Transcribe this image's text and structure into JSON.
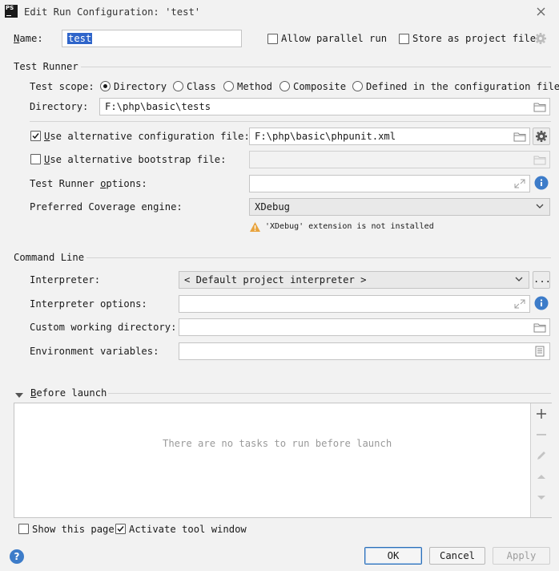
{
  "window": {
    "title": "Edit Run Configuration: 'test'",
    "app_icon_text": "PS"
  },
  "top": {
    "name_label": "Name:",
    "name_value": "test",
    "allow_parallel_label": "Allow parallel run",
    "store_project_label": "Store as project file"
  },
  "test_runner": {
    "section_title": "Test Runner",
    "scope_label": "Test scope:",
    "scopes": [
      "Directory",
      "Class",
      "Method",
      "Composite",
      "Defined in the configuration file"
    ],
    "selected_scope": "Directory",
    "directory_label": "Directory:",
    "directory_value": "F:\\php\\basic\\tests",
    "alt_config_label": "Use alternative configuration file:",
    "alt_config_checked": true,
    "alt_config_value": "F:\\php\\basic\\phpunit.xml",
    "alt_bootstrap_label": "Use alternative bootstrap file:",
    "alt_bootstrap_checked": false,
    "runner_options_label": "Test Runner options:",
    "coverage_label": "Preferred Coverage engine:",
    "coverage_value": "XDebug",
    "warning_text": "'XDebug' extension is not installed"
  },
  "command_line": {
    "section_title": "Command Line",
    "interpreter_label": "Interpreter:",
    "interpreter_value": "< Default project interpreter >",
    "interpreter_button": "...",
    "interp_options_label": "Interpreter options:",
    "working_dir_label": "Custom working directory:",
    "env_vars_label": "Environment variables:"
  },
  "before_launch": {
    "title": "Before launch",
    "empty_text": "There are no tasks to run before launch"
  },
  "bottom": {
    "show_page_label": "Show this page",
    "show_page_checked": false,
    "activate_tool_label": "Activate tool window",
    "activate_tool_checked": true,
    "ok": "OK",
    "cancel": "Cancel",
    "apply": "Apply",
    "help": "?"
  },
  "colors": {
    "accent": "#3d7cc9",
    "selection": "#2f65ca",
    "warning": "#e8a33d"
  }
}
